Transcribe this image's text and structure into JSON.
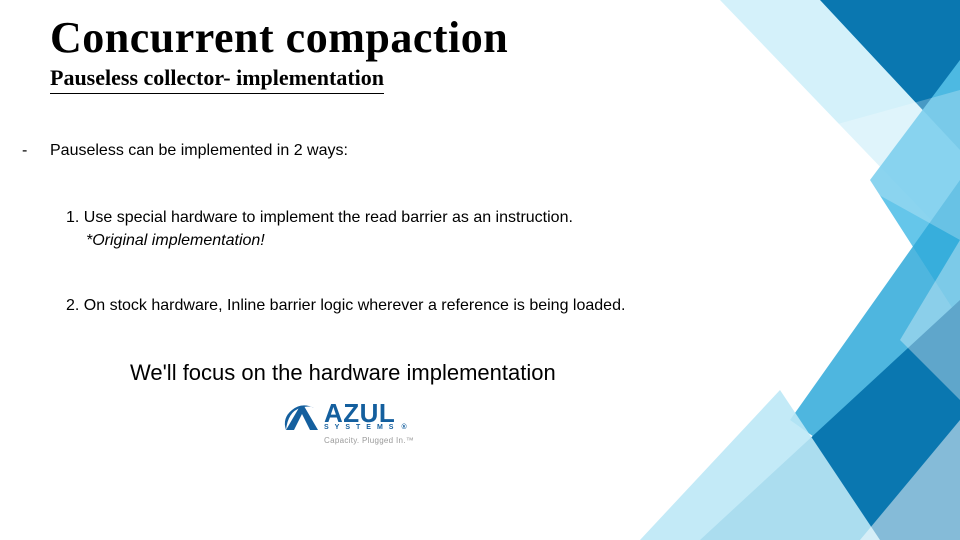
{
  "title": "Concurrent compaction",
  "subtitle": "Pauseless collector- implementation",
  "intro": "Pauseless can be implemented in 2 ways:",
  "items": [
    {
      "num": "1.",
      "text": "Use special hardware to implement the read barrier as an instruction.",
      "note": "*Original implementation!"
    },
    {
      "num": "2.",
      "text": "On stock hardware, Inline barrier logic wherever a reference is being loaded."
    }
  ],
  "focus": "We'll focus on the hardware implementation",
  "logo": {
    "brand": "AZUL",
    "sub": "SYSTEMS",
    "reg": "®",
    "tagline": "Capacity. Plugged In.™"
  },
  "colors": {
    "brand_blue": "#145f9e",
    "deco_light": "#bfe9f7",
    "deco_mid": "#4bb9e6",
    "deco_dark": "#0a77b0"
  }
}
